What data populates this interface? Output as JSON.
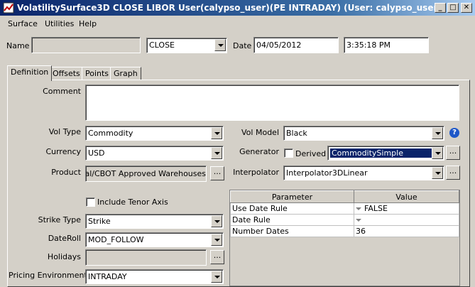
{
  "window": {
    "title": "VolatilitySurface3D CLOSE LIBOR User(calypso_user)(PE INTRADAY) (User: calypso_user)"
  },
  "menu": [
    "Surface",
    "Utilities",
    "Help"
  ],
  "header": {
    "name_label": "Name",
    "name_value": "",
    "set_value": "CLOSE",
    "date_label": "Date",
    "date_value": "04/05/2012",
    "time_value": "3:35:18 PM"
  },
  "tabs": [
    "Definition",
    "Offsets",
    "Points",
    "Graph"
  ],
  "form": {
    "comment_label": "Comment",
    "comment_value": "",
    "vol_type_label": "Vol Type",
    "vol_type_value": "Commodity",
    "currency_label": "Currency",
    "currency_value": "USD",
    "product_label": "Product",
    "product_value": "Meal/CBOT Approved Warehouses",
    "include_tenor_label": "Include Tenor Axis",
    "strike_type_label": "Strike Type",
    "strike_type_value": "Strike",
    "dateroll_label": "DateRoll",
    "dateroll_value": "MOD_FOLLOW",
    "holidays_label": "Holidays",
    "holidays_value": "",
    "pricing_env_label": "Pricing Environment",
    "pricing_env_value": "INTRADAY",
    "vol_model_label": "Vol Model",
    "vol_model_value": "Black",
    "generator_label": "Generator",
    "derived_label": "Derived",
    "generator_value": "CommoditySimple",
    "interpolator_label": "Interpolator",
    "interpolator_value": "Interpolator3DLinear",
    "ellipsis": "..."
  },
  "param_table": {
    "headers": [
      "Parameter",
      "Value"
    ],
    "rows": [
      {
        "param": "Use Date Rule",
        "value": "FALSE"
      },
      {
        "param": "Date Rule",
        "value": ""
      },
      {
        "param": "Number Dates",
        "value": "36"
      }
    ]
  },
  "colors": {
    "selected_bg": "#0a246a",
    "title_start": "#0a246a",
    "title_end": "#a6caf0"
  }
}
